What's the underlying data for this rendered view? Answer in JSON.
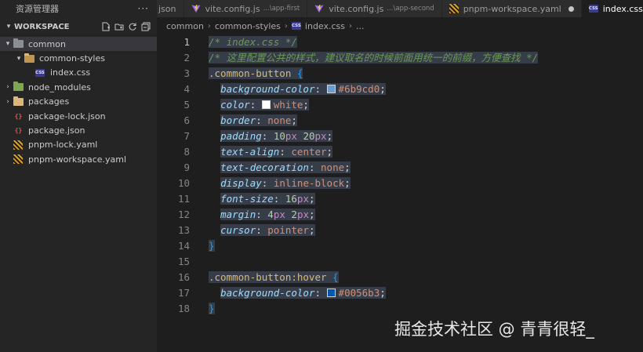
{
  "explorer": {
    "title": "资源管理器",
    "more": "···"
  },
  "workspace": {
    "title": "WORKSPACE"
  },
  "tree": [
    {
      "label": "common",
      "indent": 0,
      "twisty": "▾",
      "icon": "folder-gray",
      "selected": true
    },
    {
      "label": "common-styles",
      "indent": 1,
      "twisty": "▾",
      "icon": "folder-open",
      "selected": false
    },
    {
      "label": "index.css",
      "indent": 2,
      "twisty": "",
      "icon": "css",
      "selected": false
    },
    {
      "label": "node_modules",
      "indent": 0,
      "twisty": "›",
      "icon": "folder-green",
      "selected": false
    },
    {
      "label": "packages",
      "indent": 0,
      "twisty": "›",
      "icon": "folder",
      "selected": false
    },
    {
      "label": "package-lock.json",
      "indent": 0,
      "twisty": "",
      "icon": "json",
      "selected": false
    },
    {
      "label": "package.json",
      "indent": 0,
      "twisty": "",
      "icon": "json",
      "selected": false
    },
    {
      "label": "pnpm-lock.yaml",
      "indent": 0,
      "twisty": "",
      "icon": "yaml",
      "selected": false
    },
    {
      "label": "pnpm-workspace.yaml",
      "indent": 0,
      "twisty": "",
      "icon": "yaml",
      "selected": false
    }
  ],
  "tabs": [
    {
      "label": "json",
      "sub": "",
      "icon": "",
      "active": false,
      "dirty": false
    },
    {
      "label": "vite.config.js",
      "sub": "...\\app-first",
      "icon": "vite",
      "active": false,
      "dirty": false
    },
    {
      "label": "vite.config.js",
      "sub": "...\\app-second",
      "icon": "vite",
      "active": false,
      "dirty": false
    },
    {
      "label": "pnpm-workspace.yaml",
      "sub": "",
      "icon": "yaml",
      "active": false,
      "dirty": true
    },
    {
      "label": "index.css",
      "sub": "",
      "icon": "css",
      "active": true,
      "dirty": false
    }
  ],
  "breadcrumb": {
    "parts": [
      "common",
      "common-styles",
      "index.css",
      "..."
    ]
  },
  "editor": {
    "line_numbers": [
      "1",
      "2",
      "3",
      "4",
      "5",
      "6",
      "7",
      "8",
      "9",
      "10",
      "11",
      "12",
      "13",
      "14",
      "15",
      "16",
      "17",
      "18"
    ],
    "current_line": "1",
    "lines": [
      [
        {
          "t": "/* index.css */",
          "c": "com"
        }
      ],
      [
        {
          "t": "/* 这里配置公共的样式，建议取名的时候前面用统一的前缀，方便查找 */",
          "c": "com"
        }
      ],
      [
        {
          "t": ".common-button",
          "c": "sel"
        },
        {
          "t": " ",
          "c": "pl"
        },
        {
          "t": "{",
          "c": "brace"
        }
      ],
      [
        {
          "t": "  ",
          "c": "pl"
        },
        {
          "t": "background-color",
          "c": "prop"
        },
        {
          "t": ": ",
          "c": "pl"
        },
        {
          "t": "",
          "c": "swatch",
          "color": "#6b9cd0"
        },
        {
          "t": "#6b9cd0",
          "c": "val"
        },
        {
          "t": ";",
          "c": "pl"
        }
      ],
      [
        {
          "t": "  ",
          "c": "pl"
        },
        {
          "t": "color",
          "c": "prop"
        },
        {
          "t": ": ",
          "c": "pl"
        },
        {
          "t": "",
          "c": "swatch",
          "color": "#ffffff"
        },
        {
          "t": "white",
          "c": "val"
        },
        {
          "t": ";",
          "c": "pl"
        }
      ],
      [
        {
          "t": "  ",
          "c": "pl"
        },
        {
          "t": "border",
          "c": "prop"
        },
        {
          "t": ": ",
          "c": "pl"
        },
        {
          "t": "none",
          "c": "val"
        },
        {
          "t": ";",
          "c": "pl"
        }
      ],
      [
        {
          "t": "  ",
          "c": "pl"
        },
        {
          "t": "padding",
          "c": "prop"
        },
        {
          "t": ": ",
          "c": "pl"
        },
        {
          "t": "10",
          "c": "num"
        },
        {
          "t": "px",
          "c": "unit"
        },
        {
          "t": " ",
          "c": "pl"
        },
        {
          "t": "20",
          "c": "num"
        },
        {
          "t": "px",
          "c": "unit"
        },
        {
          "t": ";",
          "c": "pl"
        }
      ],
      [
        {
          "t": "  ",
          "c": "pl"
        },
        {
          "t": "text-align",
          "c": "prop"
        },
        {
          "t": ": ",
          "c": "pl"
        },
        {
          "t": "center",
          "c": "val"
        },
        {
          "t": ";",
          "c": "pl"
        }
      ],
      [
        {
          "t": "  ",
          "c": "pl"
        },
        {
          "t": "text-decoration",
          "c": "prop"
        },
        {
          "t": ": ",
          "c": "pl"
        },
        {
          "t": "none",
          "c": "val"
        },
        {
          "t": ";",
          "c": "pl"
        }
      ],
      [
        {
          "t": "  ",
          "c": "pl"
        },
        {
          "t": "display",
          "c": "prop"
        },
        {
          "t": ": ",
          "c": "pl"
        },
        {
          "t": "inline-block",
          "c": "val"
        },
        {
          "t": ";",
          "c": "pl"
        }
      ],
      [
        {
          "t": "  ",
          "c": "pl"
        },
        {
          "t": "font-size",
          "c": "prop"
        },
        {
          "t": ": ",
          "c": "pl"
        },
        {
          "t": "16",
          "c": "num"
        },
        {
          "t": "px",
          "c": "unit"
        },
        {
          "t": ";",
          "c": "pl"
        }
      ],
      [
        {
          "t": "  ",
          "c": "pl"
        },
        {
          "t": "margin",
          "c": "prop"
        },
        {
          "t": ": ",
          "c": "pl"
        },
        {
          "t": "4",
          "c": "num"
        },
        {
          "t": "px",
          "c": "unit"
        },
        {
          "t": " ",
          "c": "pl"
        },
        {
          "t": "2",
          "c": "num"
        },
        {
          "t": "px",
          "c": "unit"
        },
        {
          "t": ";",
          "c": "pl"
        }
      ],
      [
        {
          "t": "  ",
          "c": "pl"
        },
        {
          "t": "cursor",
          "c": "prop"
        },
        {
          "t": ": ",
          "c": "pl"
        },
        {
          "t": "pointer",
          "c": "val"
        },
        {
          "t": ";",
          "c": "pl"
        }
      ],
      [
        {
          "t": "}",
          "c": "brace"
        }
      ],
      [
        {
          "t": "",
          "c": "pl"
        }
      ],
      [
        {
          "t": ".common-button:hover",
          "c": "sel"
        },
        {
          "t": " ",
          "c": "pl"
        },
        {
          "t": "{",
          "c": "brace"
        }
      ],
      [
        {
          "t": "  ",
          "c": "pl"
        },
        {
          "t": "background-color",
          "c": "prop"
        },
        {
          "t": ": ",
          "c": "pl"
        },
        {
          "t": "",
          "c": "swatch",
          "color": "#0056b3"
        },
        {
          "t": "#0056b3",
          "c": "val"
        },
        {
          "t": ";",
          "c": "pl"
        }
      ],
      [
        {
          "t": "}",
          "c": "brace"
        }
      ]
    ]
  },
  "watermark": {
    "text": "掘金技术社区 @ 青青很轻_"
  },
  "colors": {
    "selection": "#373d48",
    "sidebar_bg": "#252526",
    "editor_bg": "#1e1e1e"
  }
}
